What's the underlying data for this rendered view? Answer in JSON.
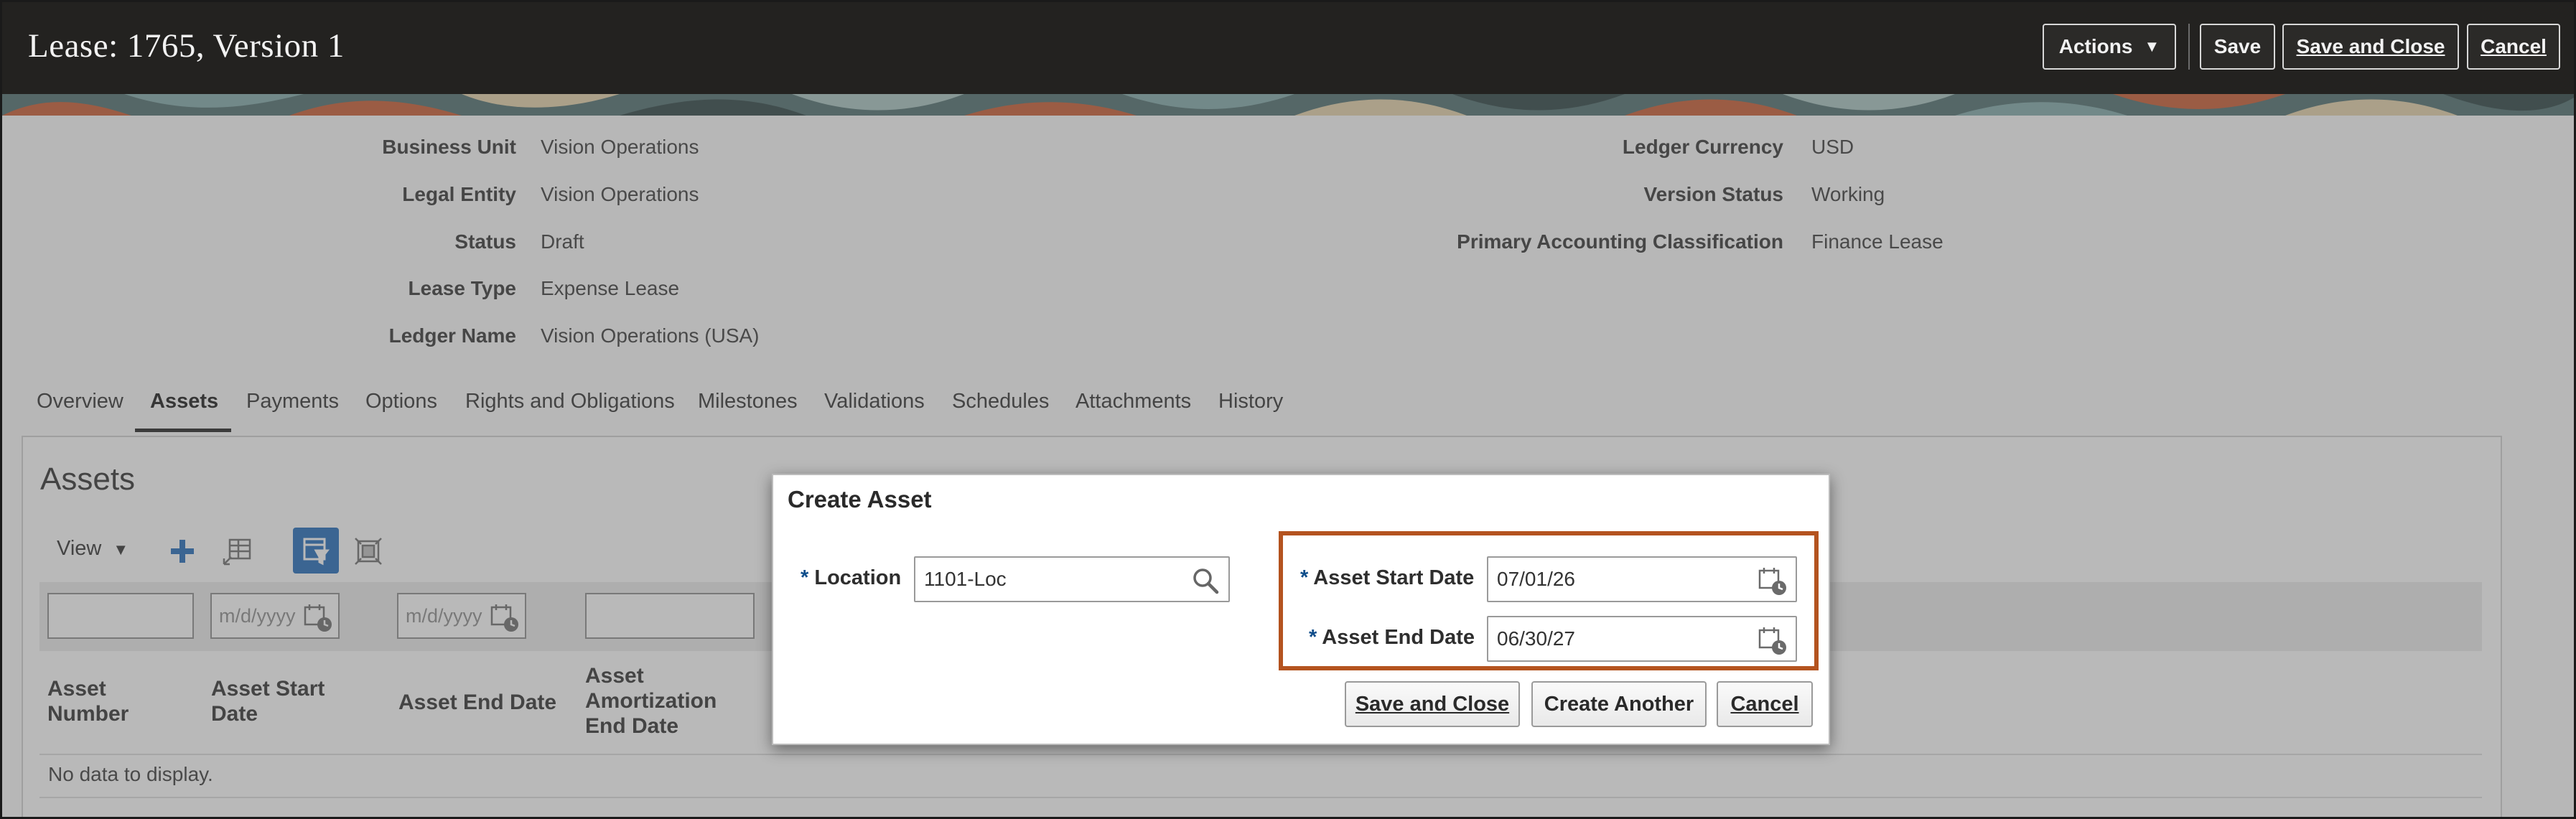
{
  "header": {
    "title": "Lease: 1765, Version 1",
    "actions_label": "Actions",
    "save_label": "Save",
    "save_close_label": "Save and Close",
    "cancel_label": "Cancel"
  },
  "details_left": [
    {
      "label": "Business Unit",
      "value": "Vision Operations"
    },
    {
      "label": "Legal Entity",
      "value": "Vision Operations"
    },
    {
      "label": "Status",
      "value": "Draft"
    },
    {
      "label": "Lease Type",
      "value": "Expense Lease"
    },
    {
      "label": "Ledger Name",
      "value": "Vision Operations (USA)"
    }
  ],
  "details_right": [
    {
      "label": "Ledger Currency",
      "value": "USD"
    },
    {
      "label": "Version Status",
      "value": "Working"
    },
    {
      "label": "Primary Accounting Classification",
      "value": "Finance Lease"
    }
  ],
  "tabs": [
    "Overview",
    "Assets",
    "Payments",
    "Options",
    "Rights and Obligations",
    "Milestones",
    "Validations",
    "Schedules",
    "Attachments",
    "History"
  ],
  "active_tab": "Assets",
  "assets": {
    "title": "Assets",
    "view_label": "View",
    "date_placeholder": "m/d/yyyy",
    "columns": {
      "asset_number": [
        "Asset",
        "Number"
      ],
      "asset_start_date": [
        "Asset Start",
        "Date"
      ],
      "asset_end_date": "Asset End Date",
      "asset_amortization_end_date": [
        "Asset",
        "Amortization",
        "End Date"
      ]
    },
    "empty_text": "No data to display."
  },
  "dialog": {
    "title": "Create Asset",
    "location_label": "Location",
    "location_value": "1101-Loc",
    "start_label": "Asset Start Date",
    "start_value": "07/01/26",
    "end_label": "Asset End Date",
    "end_value": "06/30/27",
    "required_mark": "*",
    "buttons": {
      "save_close": "Save and Close",
      "create_another": "Create Another",
      "cancel": "Cancel"
    }
  },
  "colors": {
    "header_bg": "#232220",
    "highlight": "#b4531f",
    "required": "#0e4d8a",
    "tool_blue": "#1a66b8"
  }
}
